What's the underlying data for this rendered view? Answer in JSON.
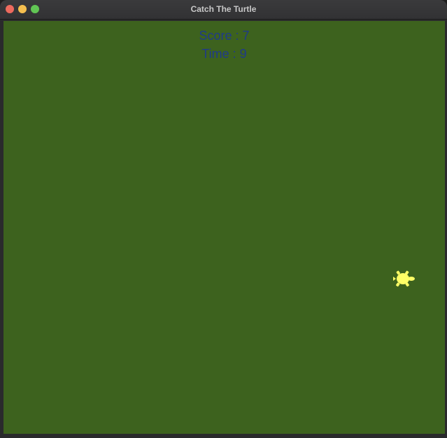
{
  "window": {
    "title": "Catch The Turtle"
  },
  "hud": {
    "score_text": "Score : 7",
    "time_text": "Time : 9"
  },
  "game": {
    "turtle_icon": "turtle-icon",
    "colors": {
      "background": "#3d621e",
      "text": "#1f3a8a",
      "turtle": "#ffff66"
    }
  }
}
